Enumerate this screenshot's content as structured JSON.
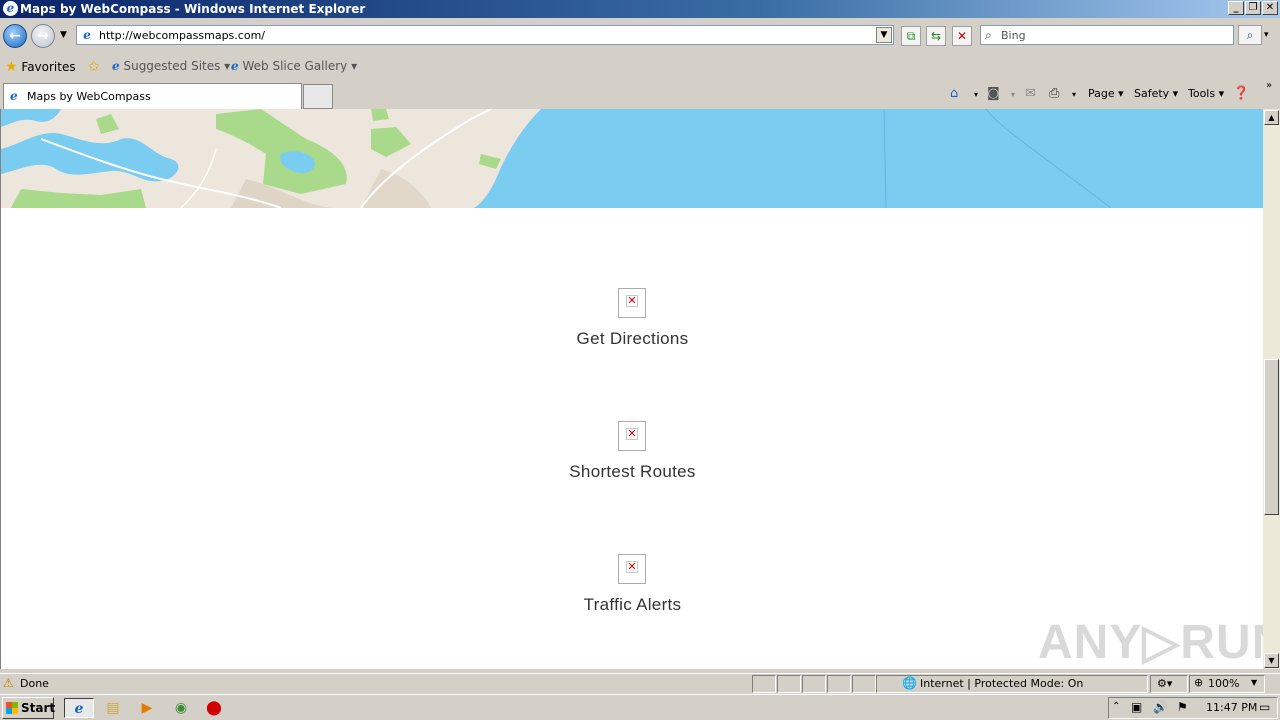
{
  "window": {
    "title": "Maps by WebCompass - Windows Internet Explorer",
    "controls": {
      "minimize": "_",
      "maximize": "❐",
      "close": "✕"
    }
  },
  "nav": {
    "url": "http://webcompassmaps.com/",
    "search_placeholder": "Bing"
  },
  "favorites_bar": {
    "favorites_label": "Favorites",
    "items": [
      "Suggested Sites ▾",
      "Web Slice Gallery ▾"
    ]
  },
  "tabs": [
    {
      "label": "Maps by WebCompass"
    }
  ],
  "command_bar": {
    "page_label": "Page ▾",
    "safety_label": "Safety ▾",
    "tools_label": "Tools ▾"
  },
  "content": {
    "features": [
      {
        "label": "Get Directions",
        "icon": "broken-image-icon"
      },
      {
        "label": "Shortest Routes",
        "icon": "broken-image-icon"
      },
      {
        "label": "Traffic Alerts",
        "icon": "broken-image-icon"
      }
    ],
    "watermark": "ANY▷RUN"
  },
  "status_bar": {
    "status": "Done",
    "zone": "Internet | Protected Mode: On",
    "zoom": "100%"
  },
  "taskbar": {
    "start_label": "Start",
    "clock": "11:47 PM"
  },
  "colors": {
    "water": "#7accf0",
    "land": "#ede6dc",
    "park": "#a9d98b",
    "titlebar": "#0a246a"
  }
}
